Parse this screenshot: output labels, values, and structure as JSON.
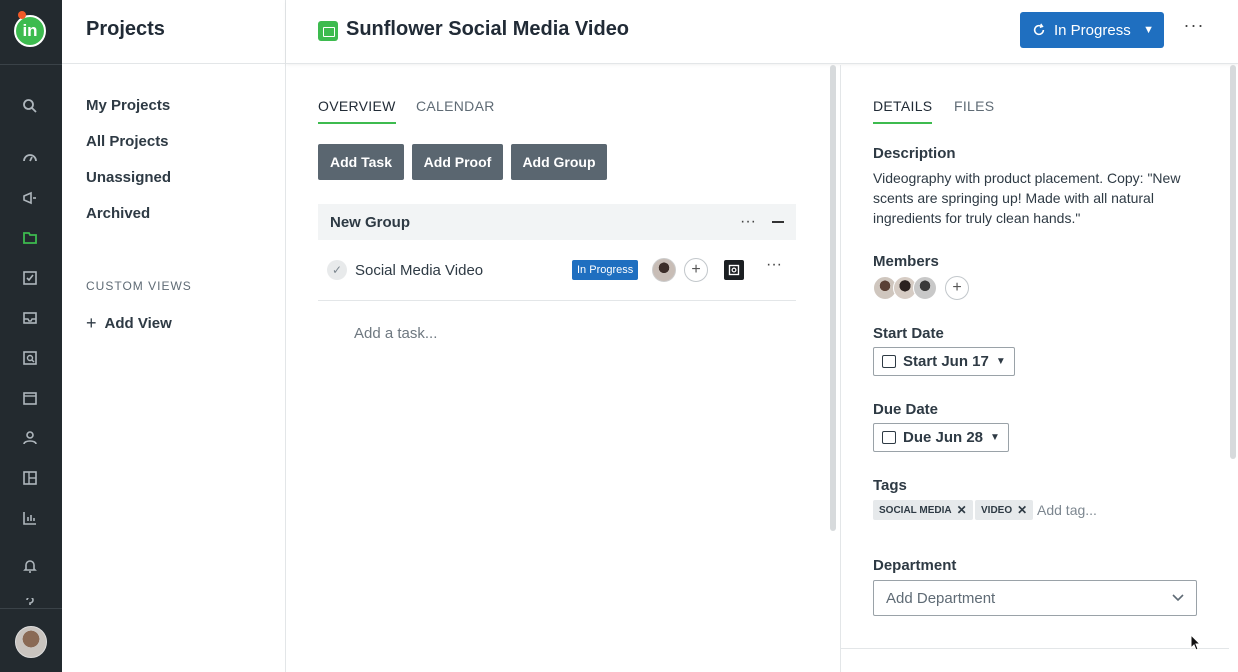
{
  "rail": {
    "logo": "in",
    "icons": [
      "search-icon",
      "dashboard-icon",
      "campaign-icon",
      "projects-icon",
      "tasks-icon",
      "inbox-icon",
      "proof-icon",
      "calendar-icon",
      "people-icon",
      "board-icon",
      "reports-icon",
      "bell-icon",
      "help-icon"
    ]
  },
  "nav": {
    "title": "Projects",
    "items": [
      "My Projects",
      "All Projects",
      "Unassigned",
      "Archived"
    ],
    "section_label": "CUSTOM VIEWS",
    "add_view": "Add View"
  },
  "header": {
    "project_title": "Sunflower Social Media Video",
    "status": "In Progress",
    "more": "···"
  },
  "overview": {
    "tabs": [
      "OVERVIEW",
      "CALENDAR"
    ],
    "buttons": [
      "Add Task",
      "Add Proof",
      "Add Group"
    ],
    "group": {
      "name": "New Group",
      "tasks": [
        {
          "name": "Social Media Video",
          "status": "In Progress"
        }
      ]
    },
    "add_task_placeholder": "Add a task..."
  },
  "details": {
    "tabs": [
      "DETAILS",
      "FILES"
    ],
    "description_label": "Description",
    "description": "Videography with product placement. Copy: \"New scents are springing up! Made with all natural ingredients for truly clean hands.\"",
    "members_label": "Members",
    "start_date_label": "Start Date",
    "start_date": "Start Jun 17",
    "due_date_label": "Due Date",
    "due_date": "Due Jun 28",
    "tags_label": "Tags",
    "tags": [
      "SOCIAL MEDIA",
      "VIDEO"
    ],
    "tag_placeholder": "Add tag...",
    "department_label": "Department",
    "department_placeholder": "Add Department"
  },
  "colors": {
    "accent_green": "#3dbb4f",
    "status_blue": "#1f6fc0",
    "rail_bg": "#232a2f"
  }
}
